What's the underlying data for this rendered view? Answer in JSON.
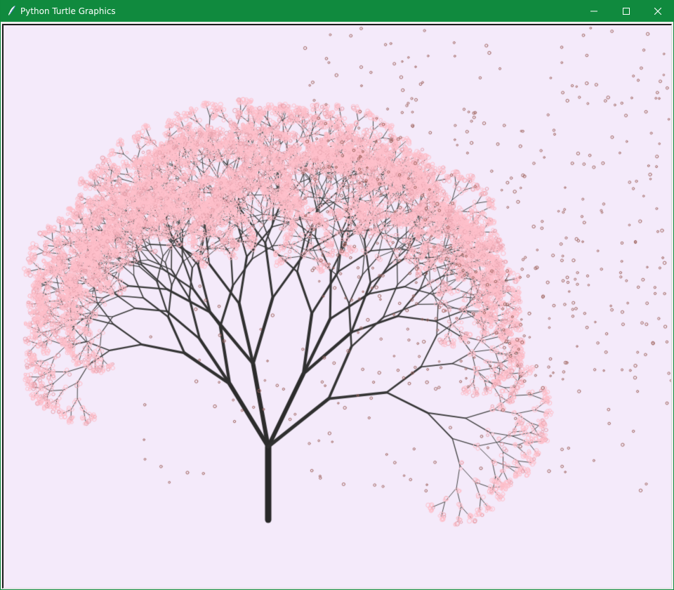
{
  "window": {
    "title": "Python Turtle Graphics",
    "icon": "feather-pen-icon",
    "controls": {
      "minimize_icon": "minimize-icon",
      "maximize_icon": "maximize-icon",
      "close_icon": "close-icon"
    }
  },
  "colors": {
    "titlebar": "#108a3e",
    "title_text": "#ffffff",
    "canvas_background": "#f4eafa",
    "trunk": "#2b2b2b",
    "branches": "#333333",
    "blossom_outline": "#ffc0cb",
    "petal_outline": "#a0655f"
  }
}
